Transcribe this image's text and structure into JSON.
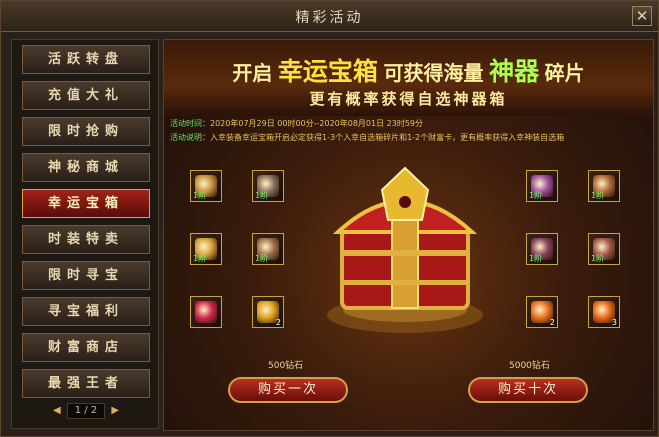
{
  "window": {
    "title": "精彩活动",
    "close_label": "✕"
  },
  "sidebar": {
    "items": [
      {
        "label": "活跃转盘"
      },
      {
        "label": "充值大礼"
      },
      {
        "label": "限时抢购"
      },
      {
        "label": "神秘商城"
      },
      {
        "label": "幸运宝箱"
      },
      {
        "label": "时装特卖"
      },
      {
        "label": "限时寻宝"
      },
      {
        "label": "寻宝福利"
      },
      {
        "label": "财富商店"
      },
      {
        "label": "最强王者"
      }
    ],
    "active_index": 4,
    "pager": {
      "prev": "◀",
      "text": "1 / 2",
      "next": "▶"
    }
  },
  "banner": {
    "part1": "开启",
    "part2": "幸运宝箱",
    "part3": "可获得海量",
    "part4": "神器",
    "part5": "碎片",
    "line2": "更有概率获得自选神器箱"
  },
  "info": {
    "time_label": "活动时间：",
    "time_value": "2020年07月29日 00时00分--2020年08月01日 23时59分",
    "desc_label": "活动说明：",
    "desc_value": "入幸装备幸运宝箱开启必定获得1-3个入幸自选箱碎片和1-2个财富卡，更有概率获得入幸神装自选箱"
  },
  "rewards_left": [
    {
      "name": "sword-icon",
      "tag": "1阶",
      "count": "",
      "color": "#c89040"
    },
    {
      "name": "armor-icon",
      "tag": "1阶",
      "count": "",
      "color": "#8a7060"
    },
    {
      "name": "blade-icon",
      "tag": "1阶",
      "count": "",
      "color": "#d8a040"
    },
    {
      "name": "chestplate-icon",
      "tag": "1阶",
      "count": "",
      "color": "#a07050"
    },
    {
      "name": "gift-box-icon",
      "tag": "",
      "count": "",
      "color": "#d02850"
    },
    {
      "name": "wealth-card-icon",
      "tag": "",
      "count": "2",
      "color": "#e0a020"
    }
  ],
  "rewards_right": [
    {
      "name": "staff-icon",
      "tag": "1阶",
      "count": "",
      "color": "#a050a0"
    },
    {
      "name": "curved-blade-icon",
      "tag": "1阶",
      "count": "",
      "color": "#b06838"
    },
    {
      "name": "whip-icon",
      "tag": "1阶",
      "count": "",
      "color": "#8a4060"
    },
    {
      "name": "wheel-icon",
      "tag": "1阶",
      "count": "",
      "color": "#a05848"
    },
    {
      "name": "fragment-icon",
      "tag": "",
      "count": "2",
      "color": "#e87020"
    },
    {
      "name": "fragment-pile-icon",
      "tag": "",
      "count": "3",
      "color": "#e86818"
    }
  ],
  "buy": {
    "once_price": "500钻石",
    "once_label": "购买一次",
    "ten_price": "5000钻石",
    "ten_label": "购买十次"
  }
}
